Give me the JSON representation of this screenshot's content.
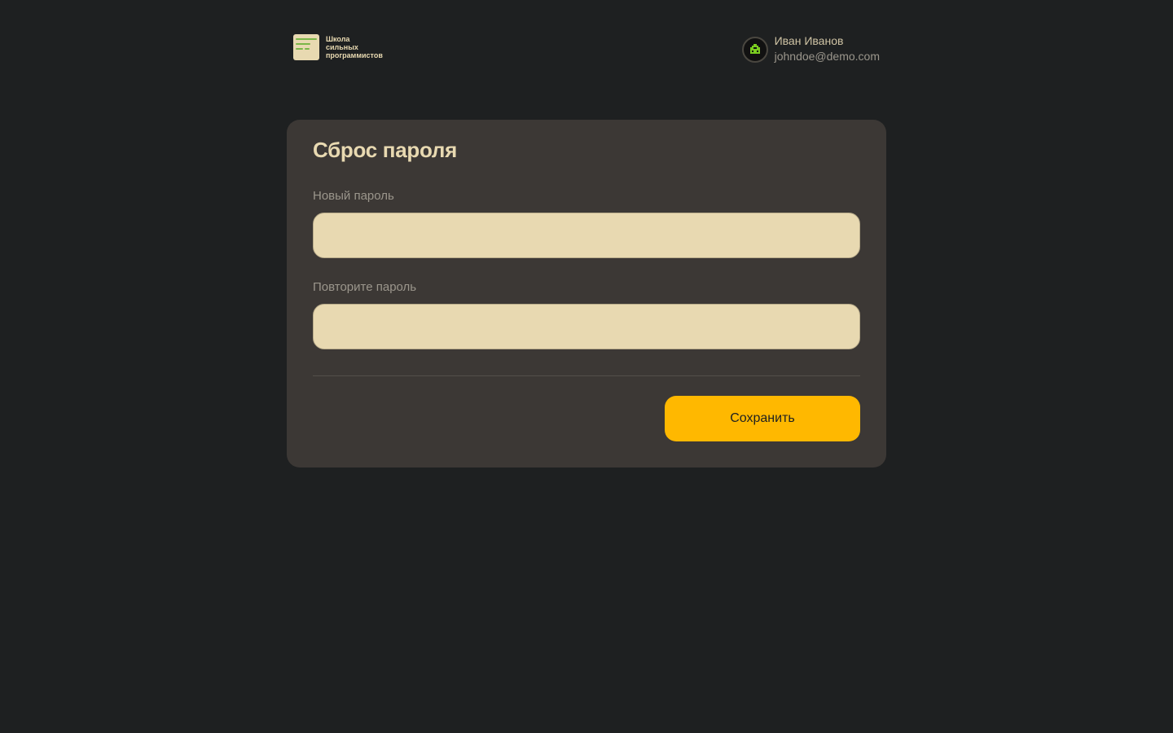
{
  "logo": {
    "line1": "Школа",
    "line2": "сильных",
    "line3": "программистов",
    "icon": "document-lines-icon"
  },
  "user": {
    "name": "Иван Иванов",
    "email": "johndoe@demo.com",
    "avatar_icon": "pixel-invader-icon"
  },
  "form": {
    "title": "Сброс пароля",
    "new_password_label": "Новый пароль",
    "new_password_value": "",
    "repeat_password_label": "Повторите пароль",
    "repeat_password_value": "",
    "save_label": "Сохранить"
  },
  "colors": {
    "background": "#1e2021",
    "card": "#3c3835",
    "input": "#e8d9b1",
    "accent": "#ffb800",
    "logo_green": "#7ab648"
  }
}
